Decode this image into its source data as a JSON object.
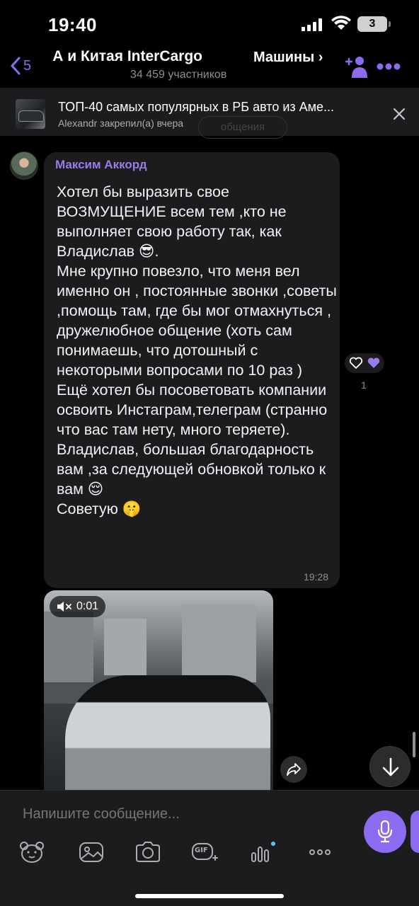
{
  "status_bar": {
    "time": "19:40",
    "battery": "3"
  },
  "header": {
    "back_count": "5",
    "title": "А и Китая InterCargo",
    "members": "34 459 участников",
    "channel_link": "Машины ›"
  },
  "pinned": {
    "title": "ТОП-40 самых популярных в РБ авто из Аме...",
    "subtitle": "Alexandr закрепил(а) вчера",
    "ghost_label": "общения"
  },
  "message": {
    "sender": "Максим Аккорд",
    "text": "Хотел бы выразить свое ВОЗМУЩЕНИЕ всем тем ,кто не выполняет свою работу так, как Владислав 😎.\nМне крупно повезло, что меня вел именно он , постоянные звонки ,советы ,помощь там, где бы мог отмахнуться , дружелюбное общение (хоть сам понимаешь, что дотошный с некоторыми вопросами по 10 раз )\nЕщё хотел бы посоветовать компании освоить Инстаграм,телеграм (странно что вас там нету, много теряете).\nВладислав, большая благодарность вам ,за следующей обновкой только к вам 😌\nСоветую 🤫",
    "time": "19:28",
    "reaction_count": "1"
  },
  "video": {
    "duration": "0:01"
  },
  "composer": {
    "placeholder": "Напишите сообщение...",
    "gif_label": "GIF"
  },
  "colors": {
    "accent": "#8b6cf0",
    "bubble": "#1c1c1e",
    "background": "#000000",
    "sender": "#9b7bea"
  },
  "icons": [
    "back-chevron-icon",
    "add-member-icon",
    "more-icon",
    "close-icon",
    "heart-icon",
    "purple-heart-icon",
    "mute-icon",
    "share-icon",
    "arrow-down-icon",
    "mic-icon",
    "sticker-icon",
    "image-icon",
    "camera-icon",
    "gif-icon",
    "poll-icon",
    "more-horizontal-icon"
  ]
}
